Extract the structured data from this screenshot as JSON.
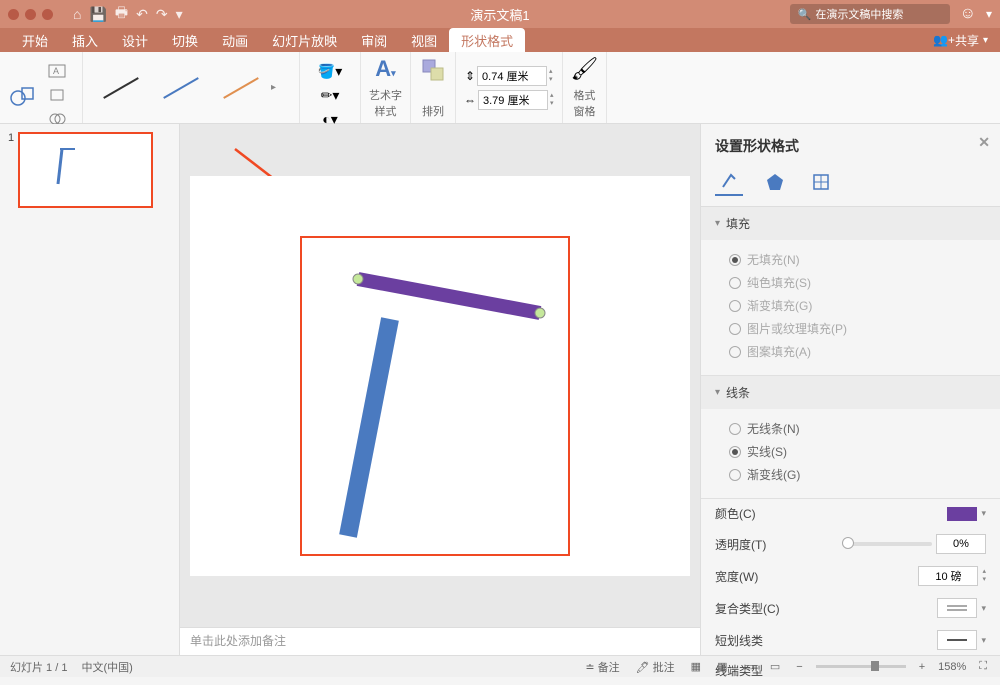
{
  "title": "演示文稿1",
  "search_placeholder": "在演示文稿中搜索",
  "menus": [
    "开始",
    "插入",
    "设计",
    "切换",
    "动画",
    "幻灯片放映",
    "审阅",
    "视图",
    "形状格式"
  ],
  "active_menu": 8,
  "share": "共享",
  "ribbon": {
    "shapes": "形状",
    "fill": "形状填充",
    "wordart": "艺术字\n样式",
    "arrange": "排列",
    "format_pane": "格式\n窗格",
    "height": "0.74 厘米",
    "width": "3.79 厘米"
  },
  "slide_number": "1",
  "notes_placeholder": "单击此处添加备注",
  "pane": {
    "title": "设置形状格式",
    "sections": {
      "fill": "填充",
      "line": "线条"
    },
    "fill_options": [
      {
        "label": "无填充(N)",
        "checked": true,
        "disabled": true
      },
      {
        "label": "纯色填充(S)",
        "checked": false,
        "disabled": true
      },
      {
        "label": "渐变填充(G)",
        "checked": false,
        "disabled": true
      },
      {
        "label": "图片或纹理填充(P)",
        "checked": false,
        "disabled": true
      },
      {
        "label": "图案填充(A)",
        "checked": false,
        "disabled": true
      }
    ],
    "line_options": [
      {
        "label": "无线条(N)",
        "checked": false
      },
      {
        "label": "实线(S)",
        "checked": true
      },
      {
        "label": "渐变线(G)",
        "checked": false
      }
    ],
    "props": {
      "color": "颜色(C)",
      "transparency": "透明度(T)",
      "transparency_val": "0%",
      "width_label": "宽度(W)",
      "width_val": "10 磅",
      "compound": "复合类型(C)",
      "dash": "短划线类",
      "cap": "线端类型"
    }
  },
  "status": {
    "slide": "幻灯片 1 / 1",
    "lang": "中文(中国)",
    "notes": "备注",
    "comments": "批注",
    "zoom": "158%"
  },
  "colors": {
    "accent": "#c37760",
    "selection": "#f04923",
    "purple": "#6b3fa0",
    "blue": "#4a7ac0"
  }
}
